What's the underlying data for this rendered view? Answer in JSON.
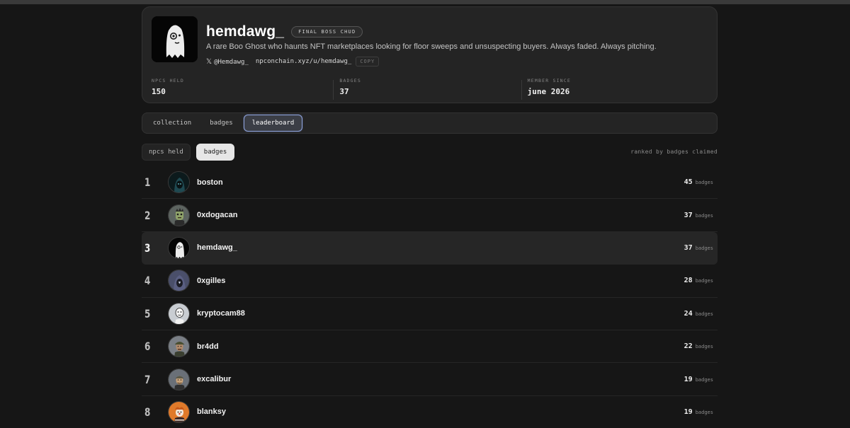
{
  "profile": {
    "name": "hemdawg_",
    "title_badge": "FINAL BOSS CHUD",
    "bio": "A rare Boo Ghost who haunts NFT marketplaces looking for floor sweeps and unsuspecting buyers. Always faded. Always pitching.",
    "x_handle": "@Hemdawg_",
    "profile_url": "npconchain.xyz/u/hemdawg_",
    "copy_label": "COPY",
    "stats": [
      {
        "label": "NPCS HELD",
        "value": "150"
      },
      {
        "label": "BADGES",
        "value": "37"
      },
      {
        "label": "MEMBER SINCE",
        "value": "june 2026"
      }
    ]
  },
  "tabs": [
    {
      "label": "collection",
      "active": false
    },
    {
      "label": "badges",
      "active": false
    },
    {
      "label": "leaderboard",
      "active": true
    }
  ],
  "subfilters": [
    {
      "label": "npcs held",
      "active": false
    },
    {
      "label": "badges",
      "active": true
    }
  ],
  "ranked_note": "ranked by badges claimed",
  "leaderboard": [
    {
      "rank": "1",
      "user": "boston",
      "score": "45",
      "unit": "badges",
      "avatar": "hooded-teal"
    },
    {
      "rank": "2",
      "user": "0xdogacan",
      "score": "37",
      "unit": "badges",
      "avatar": "zombie-green"
    },
    {
      "rank": "3",
      "user": "hemdawg_",
      "score": "37",
      "unit": "badges",
      "avatar": "boo-ghost",
      "highlight": true
    },
    {
      "rank": "4",
      "user": "0xgilles",
      "score": "28",
      "unit": "badges",
      "avatar": "hooded-gray"
    },
    {
      "rank": "5",
      "user": "kryptocam88",
      "score": "24",
      "unit": "badges",
      "avatar": "bald-white"
    },
    {
      "rank": "6",
      "user": "br4dd",
      "score": "22",
      "unit": "badges",
      "avatar": "cap-olive"
    },
    {
      "rank": "7",
      "user": "excalibur",
      "score": "19",
      "unit": "badges",
      "avatar": "helmet-tan"
    },
    {
      "rank": "8",
      "user": "blanksy",
      "score": "19",
      "unit": "badges",
      "avatar": "orange-clown"
    }
  ]
}
